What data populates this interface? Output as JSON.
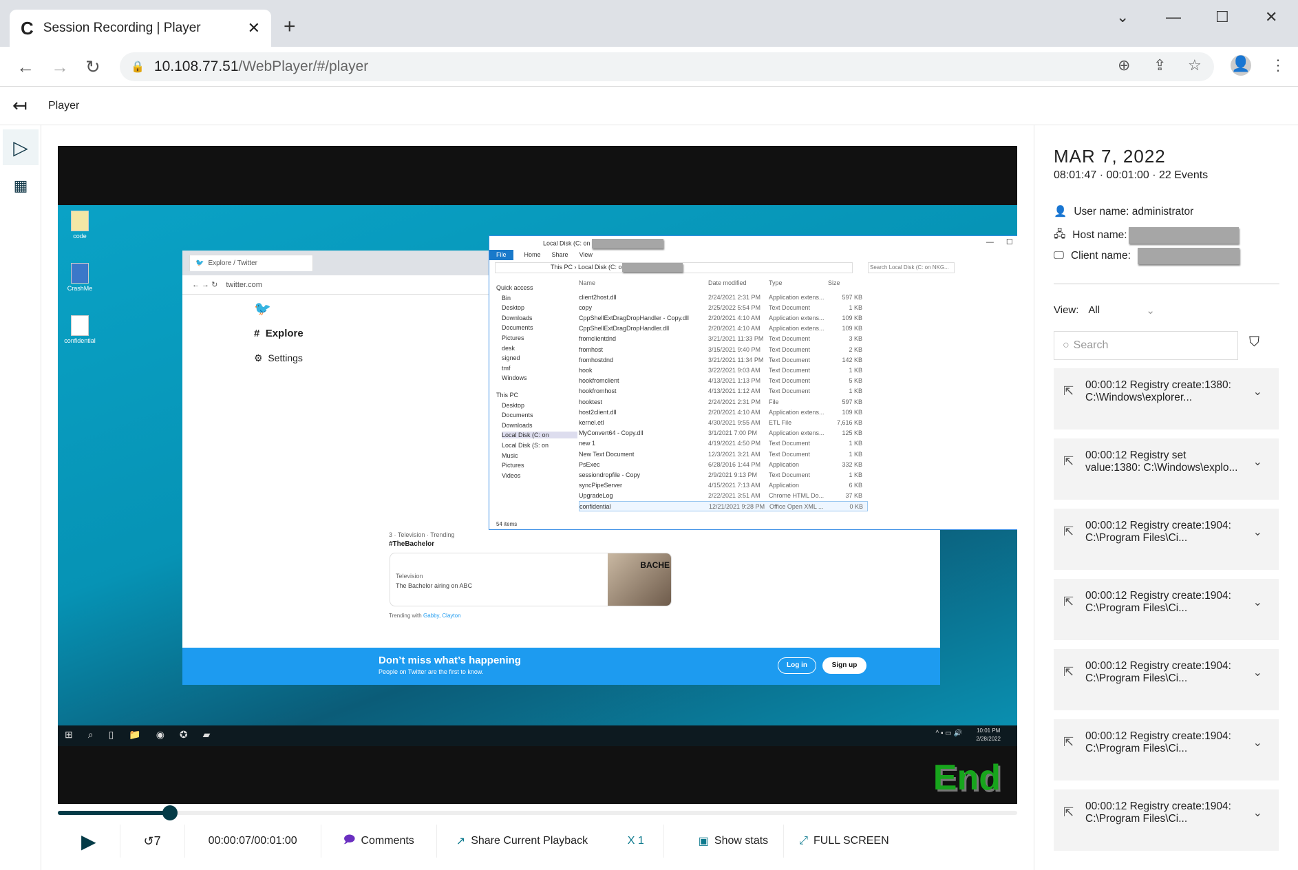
{
  "browser": {
    "tab_title": "Session Recording | Player",
    "url_host": "10.108.77.51",
    "url_path": "/WebPlayer/#/player"
  },
  "app": {
    "header_title": "Player"
  },
  "recording": {
    "desktop_icons": [
      "code",
      "CrashMe",
      "confidential"
    ],
    "twitter": {
      "tab": "Explore / Twitter",
      "url": "twitter.com",
      "nav": [
        "Explore",
        "Settings"
      ],
      "trend_meta": "3 · Television · Trending",
      "trend_tag": "#TheBachelor",
      "card_category": "Television",
      "card_text": "The Bachelor airing on ABC",
      "card_image_text": "BACHE",
      "trending_with_label": "Trending with",
      "trending_with": "Gabby, Clayton",
      "banner_title": "Don’t miss what’s happening",
      "banner_sub": "People on Twitter are the first to know.",
      "login": "Log in",
      "signup": "Sign up"
    },
    "explorer": {
      "title": "Local Disk (C: on",
      "ribbon": [
        "File",
        "Home",
        "Share",
        "View"
      ],
      "breadcrumb": [
        "This PC",
        "Local Disk (C: o"
      ],
      "search_placeholder": "Search Local Disk (C: on NKG...",
      "columns": [
        "Name",
        "Date modified",
        "Type",
        "Size"
      ],
      "nav": [
        "Quick access",
        "Bin",
        "Desktop",
        "Downloads",
        "Documents",
        "Pictures",
        "desk",
        "signed",
        "tmf",
        "Windows",
        "This PC",
        "Desktop",
        "Documents",
        "Downloads",
        "Local Disk (C: on",
        "Local Disk (S: on",
        "Music",
        "Pictures",
        "Videos"
      ],
      "files": [
        [
          "client2host.dll",
          "2/24/2021 2:31 PM",
          "Application extens...",
          "597 KB"
        ],
        [
          "copy",
          "2/25/2022 5:54 PM",
          "Text Document",
          "1 KB"
        ],
        [
          "CppShellExtDragDropHandler - Copy.dll",
          "2/20/2021 4:10 AM",
          "Application extens...",
          "109 KB"
        ],
        [
          "CppShellExtDragDropHandler.dll",
          "2/20/2021 4:10 AM",
          "Application extens...",
          "109 KB"
        ],
        [
          "fromclientdnd",
          "3/21/2021 11:33 PM",
          "Text Document",
          "3 KB"
        ],
        [
          "fromhost",
          "3/15/2021 9:40 PM",
          "Text Document",
          "2 KB"
        ],
        [
          "fromhostdnd",
          "3/21/2021 11:34 PM",
          "Text Document",
          "142 KB"
        ],
        [
          "hook",
          "3/22/2021 9:03 AM",
          "Text Document",
          "1 KB"
        ],
        [
          "hookfromclient",
          "4/13/2021 1:13 PM",
          "Text Document",
          "5 KB"
        ],
        [
          "hookfromhost",
          "4/13/2021 1:12 AM",
          "Text Document",
          "1 KB"
        ],
        [
          "hooktest",
          "2/24/2021 2:31 PM",
          "File",
          "597 KB"
        ],
        [
          "host2client.dll",
          "2/20/2021 4:10 AM",
          "Application extens...",
          "109 KB"
        ],
        [
          "kernel.etl",
          "4/30/2021 9:55 AM",
          "ETL File",
          "7,616 KB"
        ],
        [
          "MyConvert64 - Copy.dll",
          "3/1/2021 7:00 PM",
          "Application extens...",
          "125 KB"
        ],
        [
          "new 1",
          "4/19/2021 4:50 PM",
          "Text Document",
          "1 KB"
        ],
        [
          "New Text Document",
          "12/3/2021 3:21 AM",
          "Text Document",
          "1 KB"
        ],
        [
          "PsExec",
          "6/28/2016 1:44 PM",
          "Application",
          "332 KB"
        ],
        [
          "sessiondropfile - Copy",
          "2/9/2021 9:13 PM",
          "Text Document",
          "1 KB"
        ],
        [
          "syncPipeServer",
          "4/15/2021 7:13 AM",
          "Application",
          "6 KB"
        ],
        [
          "UpgradeLog",
          "2/22/2021 3:51 AM",
          "Chrome HTML Do...",
          "37 KB"
        ],
        [
          "confidential",
          "12/21/2021 9:28 PM",
          "Office Open XML ...",
          "0 KB"
        ]
      ],
      "status": "54 items"
    },
    "taskbar": {
      "time": "10:01 PM",
      "date": "2/28/2022"
    },
    "end_label": "End"
  },
  "player": {
    "progress_fraction": 0.117,
    "play_icon": "play-icon",
    "rewind_label": "7",
    "time": "00:00:07/00:01:00",
    "comments": "Comments",
    "share": "Share Current Playback",
    "speed": "X 1",
    "stats": "Show stats",
    "fullscreen": "FULL SCREEN",
    "accent": "#043b47"
  },
  "session": {
    "date": "MAR 7, 2022",
    "summary": "08:01:47 · 00:01:00 · 22 Events",
    "user_label": "User name: administrator",
    "host_label": "Host name:",
    "client_label": "Client name:"
  },
  "events": {
    "view_label": "View:",
    "view_value": "All",
    "search_placeholder": "Search",
    "items": [
      "00:00:12 Registry create:1380: C:\\Windows\\explorer...",
      "00:00:12 Registry set value:1380: C:\\Windows\\explo...",
      "00:00:12 Registry create:1904: C:\\Program Files\\Ci...",
      "00:00:12 Registry create:1904: C:\\Program Files\\Ci...",
      "00:00:12 Registry create:1904: C:\\Program Files\\Ci...",
      "00:00:12 Registry create:1904: C:\\Program Files\\Ci...",
      "00:00:12 Registry create:1904: C:\\Program Files\\Ci..."
    ]
  }
}
